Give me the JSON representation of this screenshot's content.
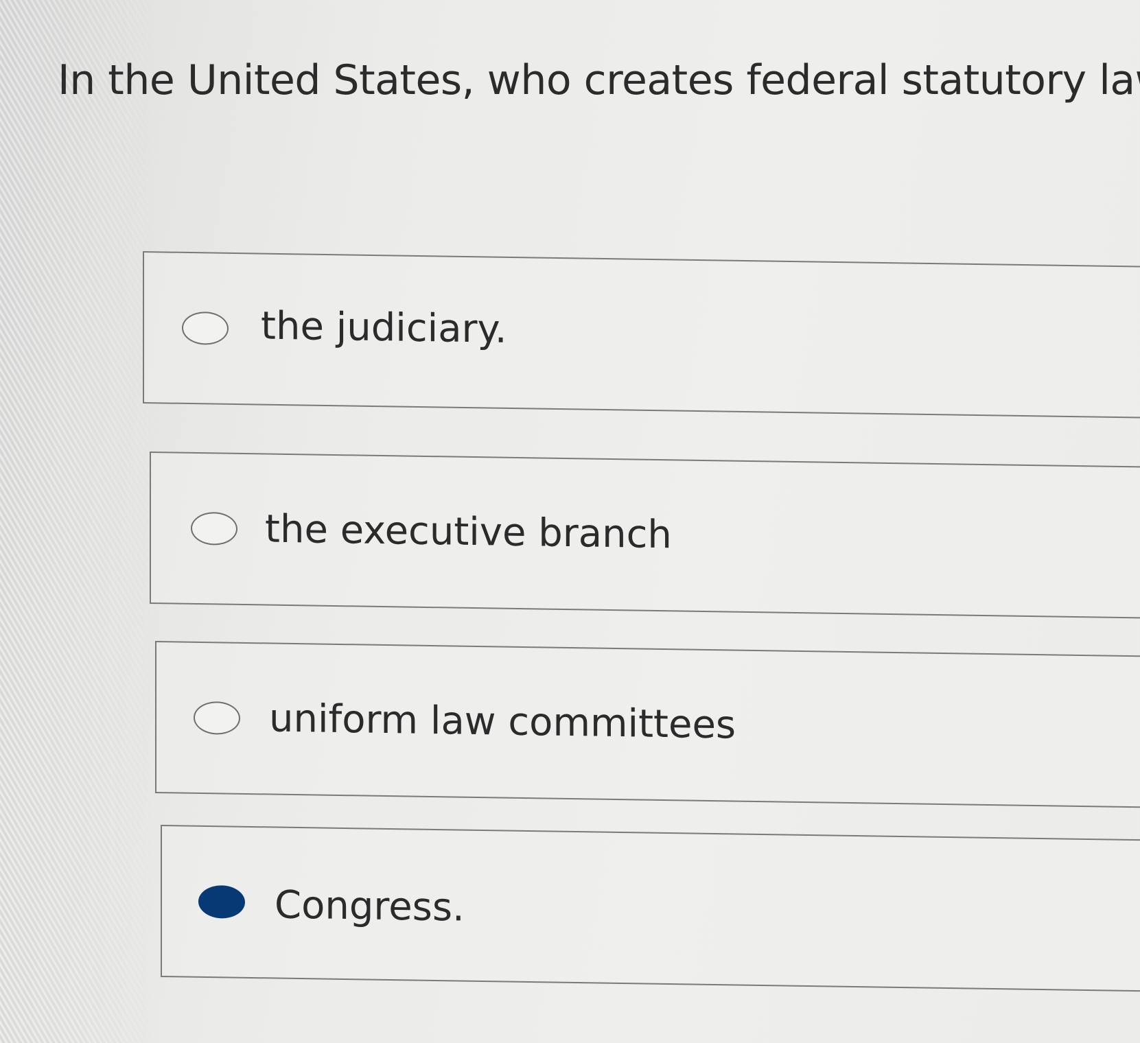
{
  "question": {
    "text": "In the United States, who creates federal statutory law?"
  },
  "options": [
    {
      "label": "the judiciary.",
      "selected": false
    },
    {
      "label": "the executive branch",
      "selected": false
    },
    {
      "label": "uniform law committees",
      "selected": false
    },
    {
      "label": "Congress.",
      "selected": true
    }
  ],
  "colors": {
    "selected_radio": "#073a75",
    "text": "#2b2b2b",
    "border": "#7a7a7a"
  }
}
